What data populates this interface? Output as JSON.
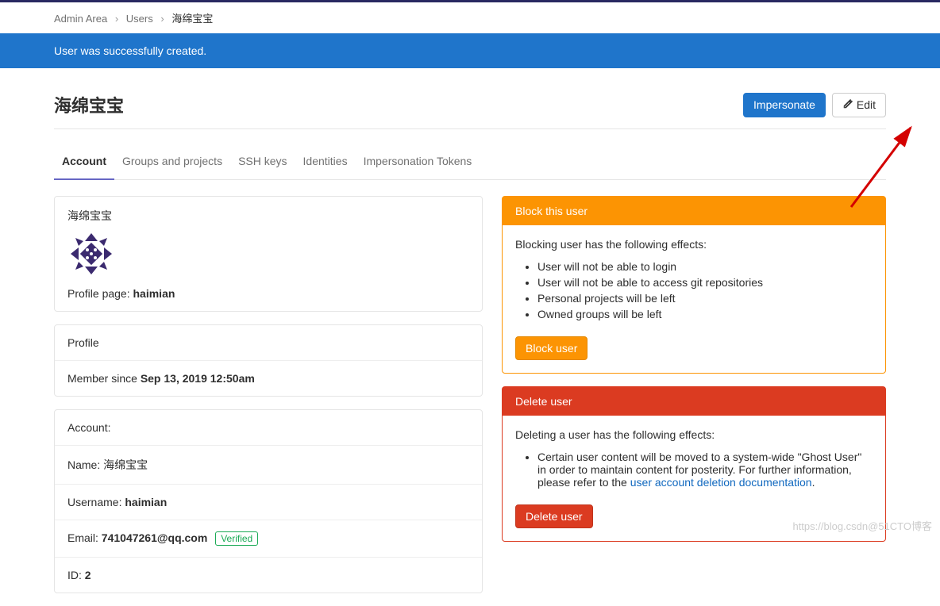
{
  "breadcrumb": {
    "root": "Admin Area",
    "section": "Users",
    "current": "海绵宝宝"
  },
  "alert": {
    "message": "User was successfully created."
  },
  "header": {
    "title": "海绵宝宝",
    "impersonate_label": "Impersonate",
    "edit_label": "Edit"
  },
  "tabs": {
    "account": "Account",
    "groups": "Groups and projects",
    "ssh": "SSH keys",
    "identities": "Identities",
    "tokens": "Impersonation Tokens"
  },
  "user_card": {
    "display_name": "海绵宝宝",
    "profile_page_label": "Profile page:",
    "profile_page_value": "haimian"
  },
  "profile_card": {
    "title": "Profile",
    "member_since_label": "Member since",
    "member_since_value": "Sep 13, 2019 12:50am"
  },
  "account_card": {
    "title": "Account:",
    "name_label": "Name:",
    "name_value": "海绵宝宝",
    "username_label": "Username:",
    "username_value": "haimian",
    "email_label": "Email:",
    "email_value": "741047261@qq.com",
    "verified_badge": "Verified",
    "id_label": "ID:",
    "id_value": "2"
  },
  "block_card": {
    "title": "Block this user",
    "intro": "Blocking user has the following effects:",
    "effects": [
      "User will not be able to login",
      "User will not be able to access git repositories",
      "Personal projects will be left",
      "Owned groups will be left"
    ],
    "button": "Block user"
  },
  "delete_card": {
    "title": "Delete user",
    "intro": "Deleting a user has the following effects:",
    "effect_prefix": "Certain user content will be moved to a system-wide \"Ghost User\" in order to maintain content for posterity. For further information, please refer to the ",
    "effect_link": "user account deletion documentation",
    "effect_suffix": ".",
    "button": "Delete user"
  },
  "watermark": "https://blog.csdn@51CTO博客"
}
